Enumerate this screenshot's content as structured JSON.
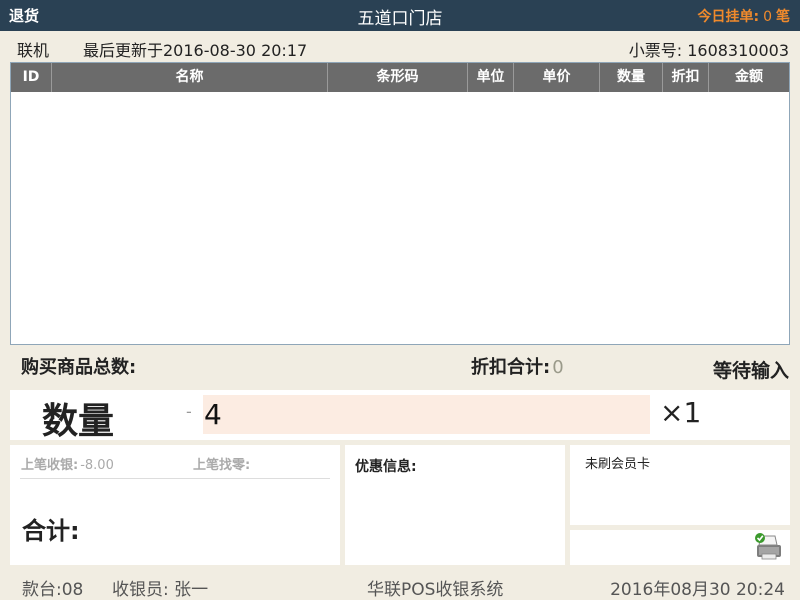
{
  "topbar": {
    "mode": "退货",
    "store_name": "五道口门店",
    "pending_label": "今日挂单:",
    "pending_count": "0",
    "pending_unit": "笔"
  },
  "infobar": {
    "connection": "联机",
    "last_updated": "最后更新于2016-08-30 20:17",
    "receipt_label": "小票号:",
    "receipt_no": "1608310003"
  },
  "grid": {
    "columns": [
      "ID",
      "名称",
      "条形码",
      "单位",
      "单价",
      "数量",
      "折扣",
      "金额"
    ],
    "rows": []
  },
  "summary": {
    "total_items_label": "购买商品总数:",
    "discount_label": "折扣合计:",
    "discount_value": "0",
    "status": "等待输入"
  },
  "quantity": {
    "label": "数量",
    "sign": "-",
    "value": "4",
    "multiplier": "×1"
  },
  "payment": {
    "prev_paid_label": "上笔收银:",
    "prev_paid_value": "-8.00",
    "prev_change_label": "上笔找零:",
    "total_label": "合计:"
  },
  "promo": {
    "label": "优惠信息:"
  },
  "member": {
    "status": "未刷会员卡"
  },
  "footer": {
    "counter": "款台:08",
    "cashier": "收银员: 张一",
    "system": "华联POS收银系统",
    "datetime": "2016年08月30  20:24"
  }
}
